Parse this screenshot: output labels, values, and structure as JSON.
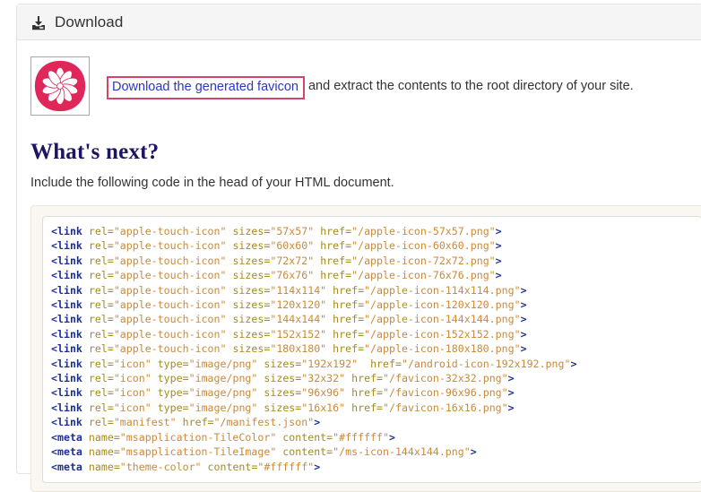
{
  "panel": {
    "title": "Download",
    "icon": "download-icon"
  },
  "favicon": {
    "alt": "generated-favicon-preview",
    "bg_color": "#e0275a",
    "petal_color": "#ffffff",
    "frame_border": "#a9a9a9"
  },
  "download_line": {
    "link_text": "Download the generated favicon",
    "link_color": "#2b36c9",
    "highlight_color": "#d6446d",
    "trailing_text": "and extract the contents to the root directory of your site."
  },
  "whats_next": {
    "heading": "What's next?",
    "heading_color": "#1c1464",
    "description": "Include the following code in the head of your HTML document."
  },
  "code_block": {
    "language": "html",
    "colors": {
      "tag": "#1c2f94",
      "attribute": "#a58a1f",
      "value": "#c98a3a",
      "background": "#ffffff",
      "well_background": "#faf7f2"
    },
    "lines": [
      {
        "tag": "link",
        "attrs": [
          [
            "rel",
            "apple-touch-icon"
          ],
          [
            "sizes",
            "57x57"
          ],
          [
            "href",
            "/apple-icon-57x57.png"
          ]
        ]
      },
      {
        "tag": "link",
        "attrs": [
          [
            "rel",
            "apple-touch-icon"
          ],
          [
            "sizes",
            "60x60"
          ],
          [
            "href",
            "/apple-icon-60x60.png"
          ]
        ]
      },
      {
        "tag": "link",
        "attrs": [
          [
            "rel",
            "apple-touch-icon"
          ],
          [
            "sizes",
            "72x72"
          ],
          [
            "href",
            "/apple-icon-72x72.png"
          ]
        ]
      },
      {
        "tag": "link",
        "attrs": [
          [
            "rel",
            "apple-touch-icon"
          ],
          [
            "sizes",
            "76x76"
          ],
          [
            "href",
            "/apple-icon-76x76.png"
          ]
        ]
      },
      {
        "tag": "link",
        "attrs": [
          [
            "rel",
            "apple-touch-icon"
          ],
          [
            "sizes",
            "114x114"
          ],
          [
            "href",
            "/apple-icon-114x114.png"
          ]
        ]
      },
      {
        "tag": "link",
        "attrs": [
          [
            "rel",
            "apple-touch-icon"
          ],
          [
            "sizes",
            "120x120"
          ],
          [
            "href",
            "/apple-icon-120x120.png"
          ]
        ]
      },
      {
        "tag": "link",
        "attrs": [
          [
            "rel",
            "apple-touch-icon"
          ],
          [
            "sizes",
            "144x144"
          ],
          [
            "href",
            "/apple-icon-144x144.png"
          ]
        ]
      },
      {
        "tag": "link",
        "attrs": [
          [
            "rel",
            "apple-touch-icon"
          ],
          [
            "sizes",
            "152x152"
          ],
          [
            "href",
            "/apple-icon-152x152.png"
          ]
        ]
      },
      {
        "tag": "link",
        "attrs": [
          [
            "rel",
            "apple-touch-icon"
          ],
          [
            "sizes",
            "180x180"
          ],
          [
            "href",
            "/apple-icon-180x180.png"
          ]
        ]
      },
      {
        "tag": "link",
        "attrs": [
          [
            "rel",
            "icon"
          ],
          [
            "type",
            "image/png"
          ],
          [
            "sizes",
            "192x192"
          ],
          [
            "href",
            "/android-icon-192x192.png"
          ]
        ],
        "extra_space_before_last": true
      },
      {
        "tag": "link",
        "attrs": [
          [
            "rel",
            "icon"
          ],
          [
            "type",
            "image/png"
          ],
          [
            "sizes",
            "32x32"
          ],
          [
            "href",
            "/favicon-32x32.png"
          ]
        ]
      },
      {
        "tag": "link",
        "attrs": [
          [
            "rel",
            "icon"
          ],
          [
            "type",
            "image/png"
          ],
          [
            "sizes",
            "96x96"
          ],
          [
            "href",
            "/favicon-96x96.png"
          ]
        ]
      },
      {
        "tag": "link",
        "attrs": [
          [
            "rel",
            "icon"
          ],
          [
            "type",
            "image/png"
          ],
          [
            "sizes",
            "16x16"
          ],
          [
            "href",
            "/favicon-16x16.png"
          ]
        ]
      },
      {
        "tag": "link",
        "attrs": [
          [
            "rel",
            "manifest"
          ],
          [
            "href",
            "/manifest.json"
          ]
        ]
      },
      {
        "tag": "meta",
        "attrs": [
          [
            "name",
            "msapplication-TileColor"
          ],
          [
            "content",
            "#ffffff"
          ]
        ]
      },
      {
        "tag": "meta",
        "attrs": [
          [
            "name",
            "msapplication-TileImage"
          ],
          [
            "content",
            "/ms-icon-144x144.png"
          ]
        ]
      },
      {
        "tag": "meta",
        "attrs": [
          [
            "name",
            "theme-color"
          ],
          [
            "content",
            "#ffffff"
          ]
        ]
      }
    ]
  }
}
